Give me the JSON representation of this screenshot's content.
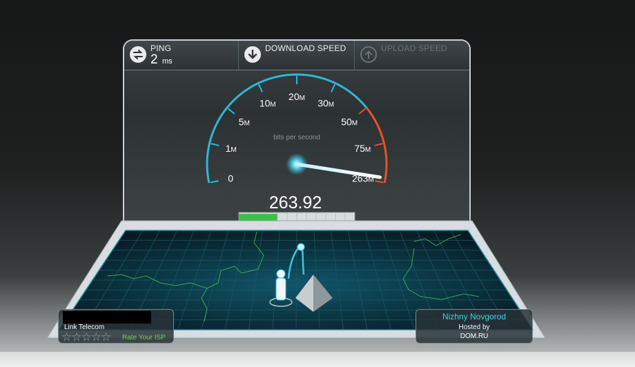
{
  "tabs": {
    "ping": {
      "label": "PING",
      "value": "2",
      "unit": "ms"
    },
    "download": {
      "label": "DOWNLOAD SPEED"
    },
    "upload": {
      "label": "UPLOAD SPEED"
    }
  },
  "gauge": {
    "unit_caption": "bits per second",
    "reading": "263.92",
    "ticks": [
      "0",
      "1",
      "5",
      "10",
      "20",
      "30",
      "50",
      "75",
      "263"
    ],
    "tick_suffix": "M",
    "needle_fraction": 0.985,
    "progress_fraction": 0.33
  },
  "isp": {
    "name": "Link Telecom",
    "stars": "☆☆☆☆☆",
    "rate_label": "Rate Your ISP"
  },
  "server": {
    "city": "Nizhny Novgorod",
    "hosted_label": "Hosted by",
    "host": "DOM.RU"
  },
  "colors": {
    "accent": "#2fb8d8",
    "hot": "#e8532a",
    "progress": "#3fbf4a"
  }
}
